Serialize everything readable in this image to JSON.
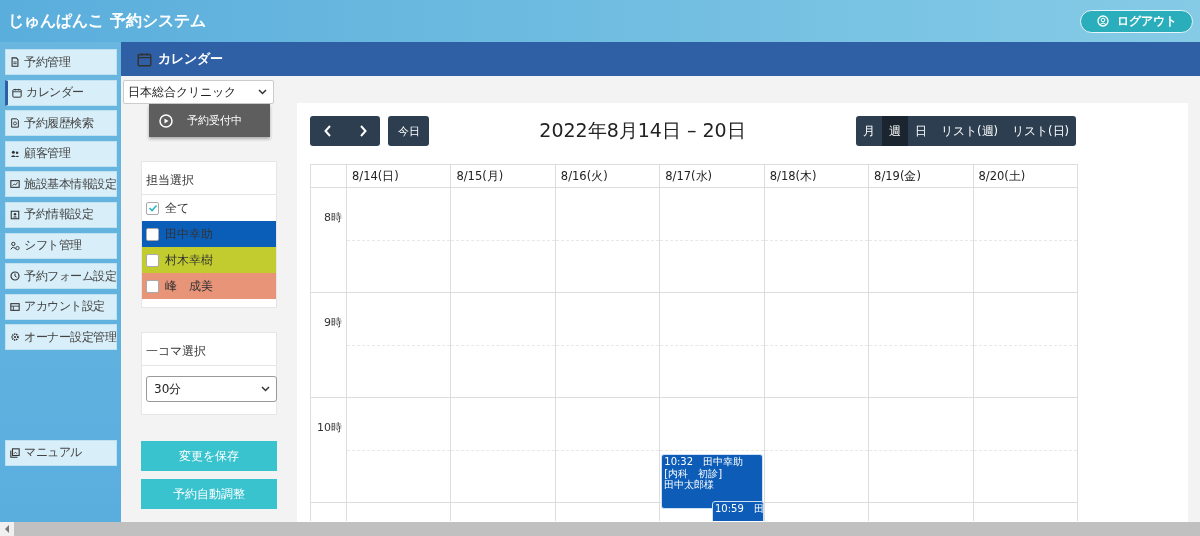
{
  "header": {
    "title": "じゅんぱんこ 予約システム",
    "logout": "ログアウト"
  },
  "sidebar": {
    "items": [
      {
        "label": "予約管理",
        "selected": false
      },
      {
        "label": "カレンダー",
        "selected": true
      },
      {
        "label": "予約履歴検索",
        "selected": false
      },
      {
        "label": "顧客管理",
        "selected": false
      },
      {
        "label": "施設基本情報設定",
        "selected": false
      },
      {
        "label": "予約情報設定",
        "selected": false
      },
      {
        "label": "シフト管理",
        "selected": false
      },
      {
        "label": "予約フォーム設定",
        "selected": false
      },
      {
        "label": "アカウント設定",
        "selected": false
      },
      {
        "label": "オーナー設定管理",
        "selected": false
      }
    ],
    "bottom_items": [
      {
        "label": "マニュアル",
        "selected": false
      }
    ]
  },
  "page_title": "カレンダー",
  "clinic_select": {
    "value": "日本総合クリニック"
  },
  "reception_button": "予約受付中",
  "staff_select": {
    "title": "担当選択",
    "all": {
      "label": "全て",
      "checked": true
    },
    "staff": [
      {
        "label": "田中幸助",
        "checked": false,
        "color": "#0b5eb8"
      },
      {
        "label": "村木幸樹",
        "checked": false,
        "color": "#c3cc2e"
      },
      {
        "label": "峰　成美",
        "checked": false,
        "color": "#e89479"
      }
    ]
  },
  "slot_select": {
    "title": "一コマ選択",
    "value": "30分"
  },
  "save_button": "変更を保存",
  "auto_adjust_button": "予約自動調整",
  "calendar": {
    "today": "今日",
    "range_title": "2022年8月14日 – 20日",
    "views": [
      {
        "label": "月",
        "selected": false
      },
      {
        "label": "週",
        "selected": true
      },
      {
        "label": "日",
        "selected": false
      },
      {
        "label": "リスト(週)",
        "selected": false
      },
      {
        "label": "リスト(日)",
        "selected": false
      }
    ],
    "hours": [
      "8時",
      "9時",
      "10時"
    ],
    "days": [
      {
        "label": "8/14(日)"
      },
      {
        "label": "8/15(月)"
      },
      {
        "label": "8/16(火)"
      },
      {
        "label": "8/17(水)",
        "events": [
          {
            "lines": [
              "10:32　田中幸助",
              "[内科　初診]",
              "田中太郎様"
            ]
          },
          {
            "lines": [
              "10:59　田"
            ]
          }
        ]
      },
      {
        "label": "8/18(木)"
      },
      {
        "label": "8/19(金)"
      },
      {
        "label": "8/20(土)"
      }
    ]
  }
}
